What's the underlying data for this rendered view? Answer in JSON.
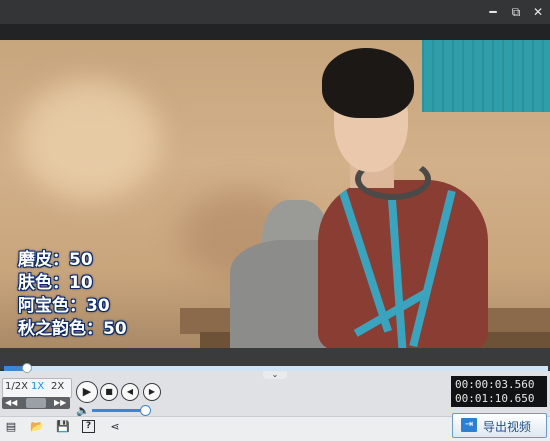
{
  "window": {
    "controls": {
      "minimize": "━",
      "maximize": "⧉",
      "close": "✕"
    }
  },
  "overlay": {
    "lines": [
      "磨皮：50",
      "肤色：10",
      "阿宝色：30",
      "秋之韵色：50"
    ]
  },
  "playback": {
    "progress_fraction": 0.006,
    "speed_options": [
      "1/2X",
      "1X",
      "2X"
    ],
    "selected_speed": "1X",
    "speed_slider_left": "◀◀",
    "speed_slider_right": "▶▶",
    "buttons": {
      "play": "▶",
      "stop": "■",
      "prev": "◀",
      "next": "▶"
    },
    "volume_fraction": 0.95,
    "volume_icon": "🔈",
    "current_time": "00:00:03.560",
    "total_time": "00:01:10.650",
    "collapse_glyph": "⌄"
  },
  "toolbar": {
    "icons": [
      "new-file-icon",
      "open-folder-icon",
      "save-icon",
      "help-icon",
      "share-icon"
    ],
    "icon_glyphs": [
      "▤",
      "📂",
      "💾",
      "?",
      "⋖"
    ],
    "export_label": "导出视频",
    "export_icon_glyph": "⇥"
  },
  "colors": {
    "accent": "#3b86d6",
    "overlay_text": "#ffffff",
    "overlay_outline": "#0a2a6a",
    "timebox_bg": "#111214"
  }
}
